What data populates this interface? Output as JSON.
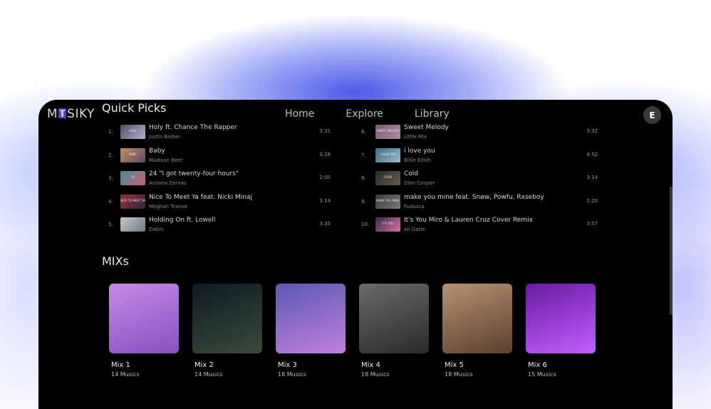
{
  "app": {
    "logo": "MUSIKY",
    "logo_parts": [
      "M",
      "SIKY"
    ],
    "profile_initial": "E"
  },
  "nav": [
    "Home",
    "Explore",
    "Library"
  ],
  "quick_picks": {
    "title": "Quick Picks",
    "left": [
      {
        "num": "1.",
        "title": "Holy ft. Chance The Rapper",
        "artist": "Justin Bieber",
        "duration": "3:31",
        "thumb_text": "HOLY",
        "colors": [
          "#4a4a6a",
          "#b7b7c7"
        ]
      },
      {
        "num": "2.",
        "title": "Baby",
        "artist": "Madison Beer",
        "duration": "3:28",
        "thumb_text": "BABY",
        "colors": [
          "#c88d5a",
          "#5a4a6a"
        ]
      },
      {
        "num": "3.",
        "title": "24 \"I got twenty-four hours\"",
        "artist": "Arizona Zervas",
        "duration": "2:00",
        "thumb_text": "24",
        "colors": [
          "#3f8f9a",
          "#d65a78"
        ]
      },
      {
        "num": "4.",
        "title": "Nice To Meet Ya feat. Nicki Minaj",
        "artist": "Meghan Trainor",
        "duration": "3:14",
        "thumb_text": "NICE TO MEET YA",
        "colors": [
          "#a02b3a",
          "#2a2a3a"
        ]
      },
      {
        "num": "5.",
        "title": "Holding On ft. Lowell",
        "artist": "Dabin",
        "duration": "3:35",
        "thumb_text": "",
        "colors": [
          "#c7c7c7",
          "#6e7a88"
        ]
      }
    ],
    "right": [
      {
        "num": "6.",
        "title": "Sweet Melody",
        "artist": "Little Mix",
        "duration": "3:32",
        "thumb_text": "SWEET MELODY",
        "colors": [
          "#7a5a7a",
          "#b08aa0"
        ]
      },
      {
        "num": "7.",
        "title": "i love you",
        "artist": "Billie Eilish",
        "duration": "4:52",
        "thumb_text": "I LOVE YOU",
        "colors": [
          "#3b6f8a",
          "#9ab8c8"
        ]
      },
      {
        "num": "8.",
        "title": "Cold",
        "artist": "Dion Cooper",
        "duration": "3:14",
        "thumb_text": "COLD",
        "colors": [
          "#2a2a2a",
          "#6a5a4a"
        ]
      },
      {
        "num": "9.",
        "title": "make you mine feat. Snøw, Powfu, Rxseboy",
        "artist": "Fudasca",
        "duration": "2:20",
        "thumb_text": "MAKE YOU MINE",
        "colors": [
          "#3a3a3a",
          "#7a7a7a"
        ]
      },
      {
        "num": "10.",
        "title": "It's You Miro & Lauren Cruz Cover Remix",
        "artist": "Ali Gatie",
        "duration": "3:57",
        "thumb_text": "IT'S YOU",
        "colors": [
          "#3a2a4a",
          "#d070a0"
        ]
      }
    ]
  },
  "mixes": {
    "title": "MIXs",
    "items": [
      {
        "name": "Mix 1",
        "count": "14 Musics",
        "colors": [
          "#c58be6",
          "#8a4ec0"
        ]
      },
      {
        "name": "Mix 2",
        "count": "14 Musics",
        "colors": [
          "#0f1a24",
          "#3a4a3a"
        ]
      },
      {
        "name": "Mix 3",
        "count": "18 Musics",
        "colors": [
          "#5a5ab0",
          "#c080e0"
        ]
      },
      {
        "name": "Mix 4",
        "count": "18 Musics",
        "colors": [
          "#6a6a6a",
          "#2a2a2a"
        ]
      },
      {
        "name": "Mix 5",
        "count": "18 Musics",
        "colors": [
          "#b89070",
          "#5a4030"
        ]
      },
      {
        "name": "Mix 6",
        "count": "15 Musics",
        "colors": [
          "#6a1aa0",
          "#c060ff"
        ]
      }
    ]
  }
}
